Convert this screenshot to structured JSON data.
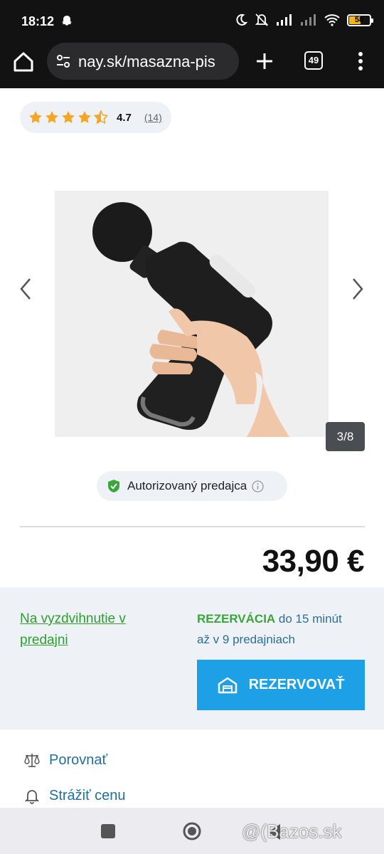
{
  "status_bar": {
    "time": "18:12",
    "battery": "58"
  },
  "browser": {
    "url": "nay.sk/masazna-pis",
    "tab_count": "49"
  },
  "rating": {
    "value": "4.7",
    "count": "(14)",
    "stars": 4.5
  },
  "gallery": {
    "counter": "3/8"
  },
  "authorized": {
    "label": "Autorizovaný predajca"
  },
  "price": "33,90 €",
  "reservation": {
    "pickup_link": "Na vyzdvihnutie v predajni",
    "headline": "REZERVÁCIA",
    "line1_rest": " do 15 minút",
    "line2": "až v 9 predajniach",
    "button_label": "REZERVOVAŤ"
  },
  "actions": {
    "compare": "Porovnať",
    "watch_price": "Strážiť cenu"
  },
  "watermark": "@(Bazos.sk",
  "colors": {
    "accent_blue": "#1ea0e6",
    "green": "#3aa63a",
    "star": "#f5a623"
  }
}
